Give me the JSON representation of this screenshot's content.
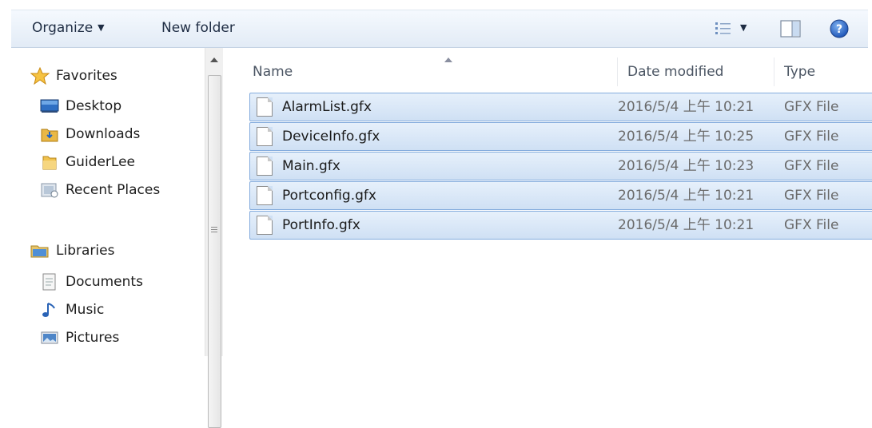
{
  "toolbar": {
    "organize_label": "Organize",
    "new_folder_label": "New folder"
  },
  "nav": {
    "favorites": {
      "label": "Favorites",
      "items": [
        {
          "label": "Desktop",
          "icon": "desktop-icon"
        },
        {
          "label": "Downloads",
          "icon": "downloads-folder-icon"
        },
        {
          "label": "GuiderLee",
          "icon": "user-folder-icon"
        },
        {
          "label": "Recent Places",
          "icon": "recent-places-icon"
        }
      ]
    },
    "libraries": {
      "label": "Libraries",
      "items": [
        {
          "label": "Documents",
          "icon": "documents-icon"
        },
        {
          "label": "Music",
          "icon": "music-icon"
        },
        {
          "label": "Pictures",
          "icon": "pictures-icon"
        }
      ]
    }
  },
  "columns": {
    "name": "Name",
    "date": "Date modified",
    "type": "Type"
  },
  "files": [
    {
      "name": "AlarmList.gfx",
      "date": "2016/5/4 上午 10:21",
      "type": "GFX File"
    },
    {
      "name": "DeviceInfo.gfx",
      "date": "2016/5/4 上午 10:25",
      "type": "GFX File"
    },
    {
      "name": "Main.gfx",
      "date": "2016/5/4 上午 10:23",
      "type": "GFX File"
    },
    {
      "name": "Portconfig.gfx",
      "date": "2016/5/4 上午 10:21",
      "type": "GFX File"
    },
    {
      "name": "PortInfo.gfx",
      "date": "2016/5/4 上午 10:21",
      "type": "GFX File"
    }
  ],
  "colors": {
    "selection_fill": "#cfe0f4",
    "selection_border": "#84acdd",
    "toolbar_bg": "#e2ebf6"
  }
}
